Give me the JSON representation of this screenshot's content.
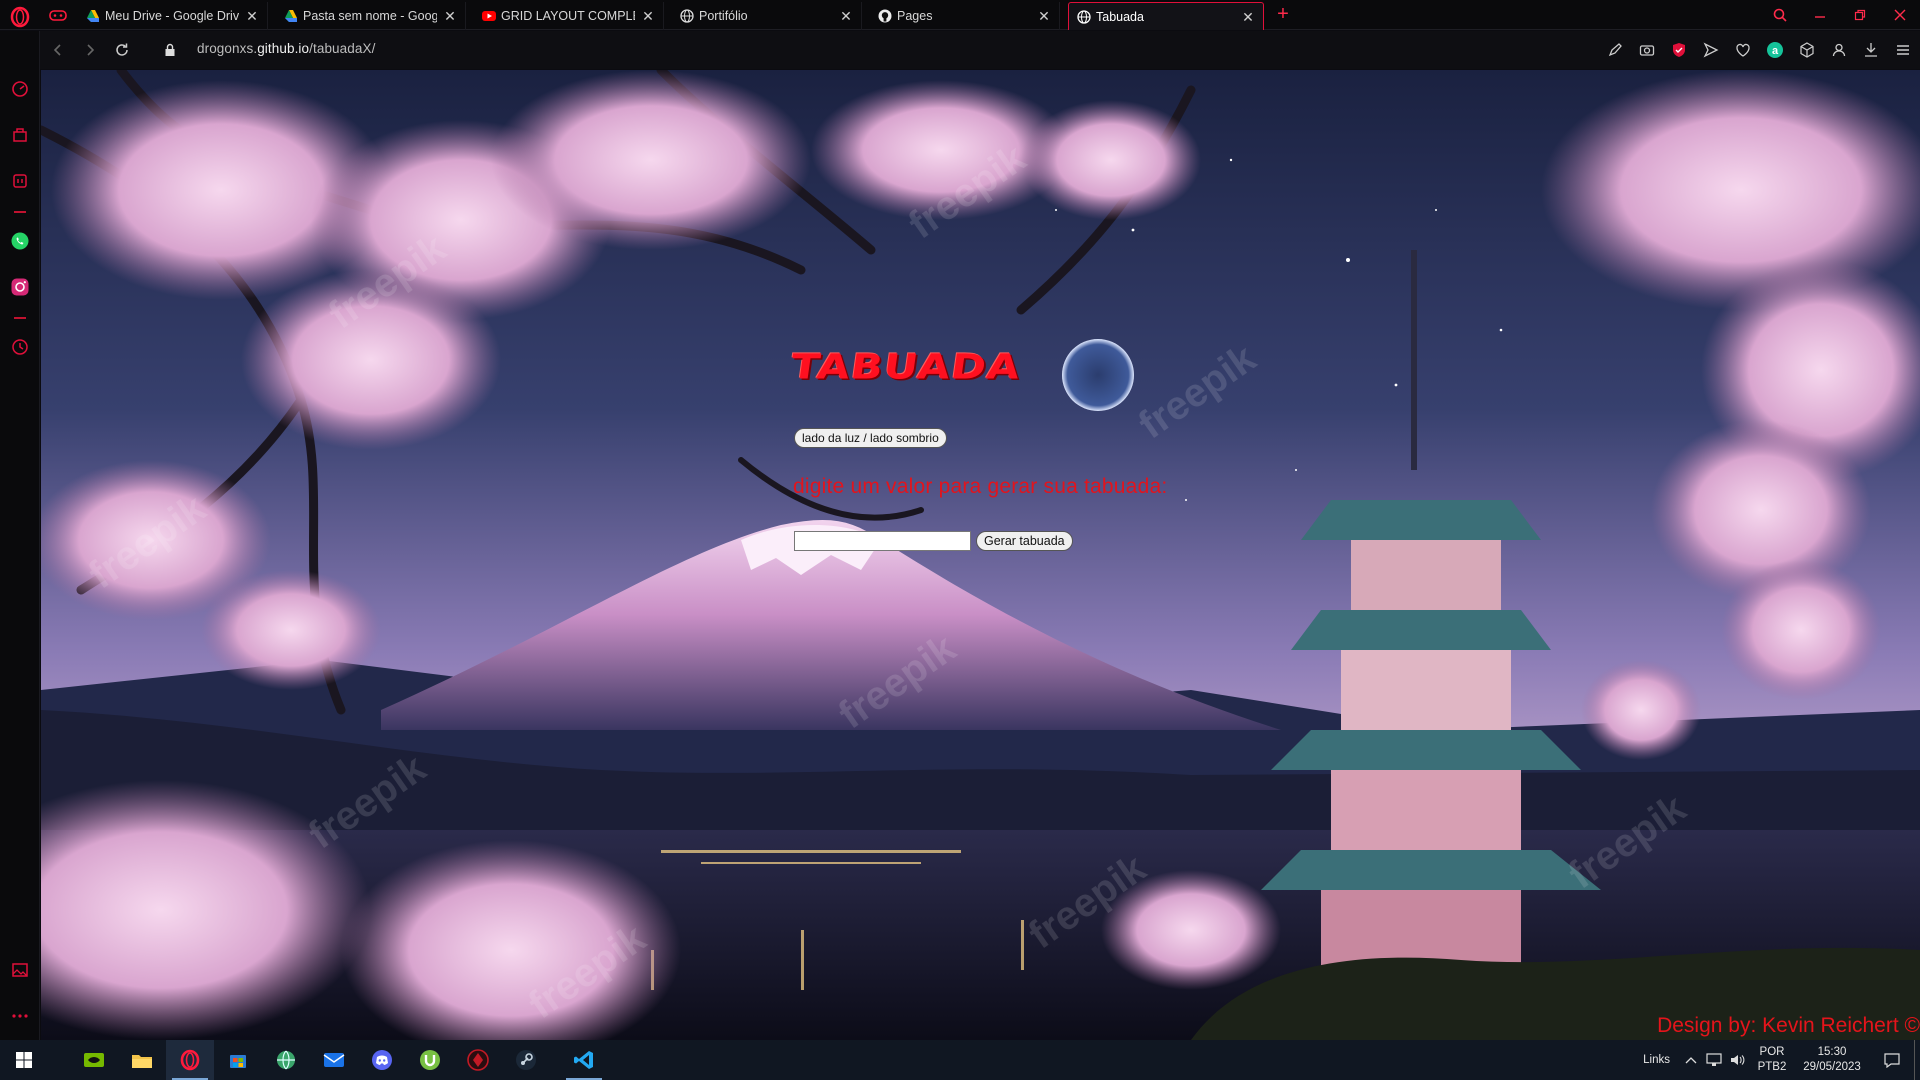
{
  "browser": {
    "tabs": [
      {
        "label": "Meu Drive - Google Drive",
        "icon": "google-drive-icon",
        "active": false
      },
      {
        "label": "Pasta sem nome - Google D",
        "icon": "google-drive-icon",
        "active": false
      },
      {
        "label": "GRID LAYOUT COMPLEXO",
        "icon": "youtube-icon",
        "active": false
      },
      {
        "label": "Portifólio",
        "icon": "globe-icon",
        "active": false
      },
      {
        "label": "Pages",
        "icon": "github-icon",
        "active": false
      },
      {
        "label": "Tabuada",
        "icon": "globe-icon",
        "active": true
      }
    ],
    "new_tab": "+",
    "url_domain": "drogonxs.github.io",
    "url_pre": "drogonxs.",
    "url_host": "github.io",
    "url_path": "/tabuadaX/",
    "accent": "#e0103a"
  },
  "page": {
    "title": "TABUADA",
    "theme_button": "lado da luz / lado sombrio",
    "prompt": "digite um valor para gerar sua tabuada:",
    "input_value": "",
    "generate_button": "Gerar tabuada",
    "credit": "Design by: Kevin Reichert ©",
    "text_color": "#e2141d",
    "watermark": "freepik"
  },
  "taskbar": {
    "apps": [
      "windows-start-icon",
      "nvidia-icon",
      "file-explorer-icon",
      "opera-gx-icon",
      "microsoft-store-icon",
      "browser-globe-icon",
      "mail-icon",
      "discord-icon",
      "utorrent-icon",
      "game-app-icon",
      "steam-icon",
      "vscode-icon"
    ],
    "tray_links": "Links",
    "lang_top": "POR",
    "lang_bottom": "PTB2",
    "time": "15:30",
    "date": "29/05/2023"
  }
}
